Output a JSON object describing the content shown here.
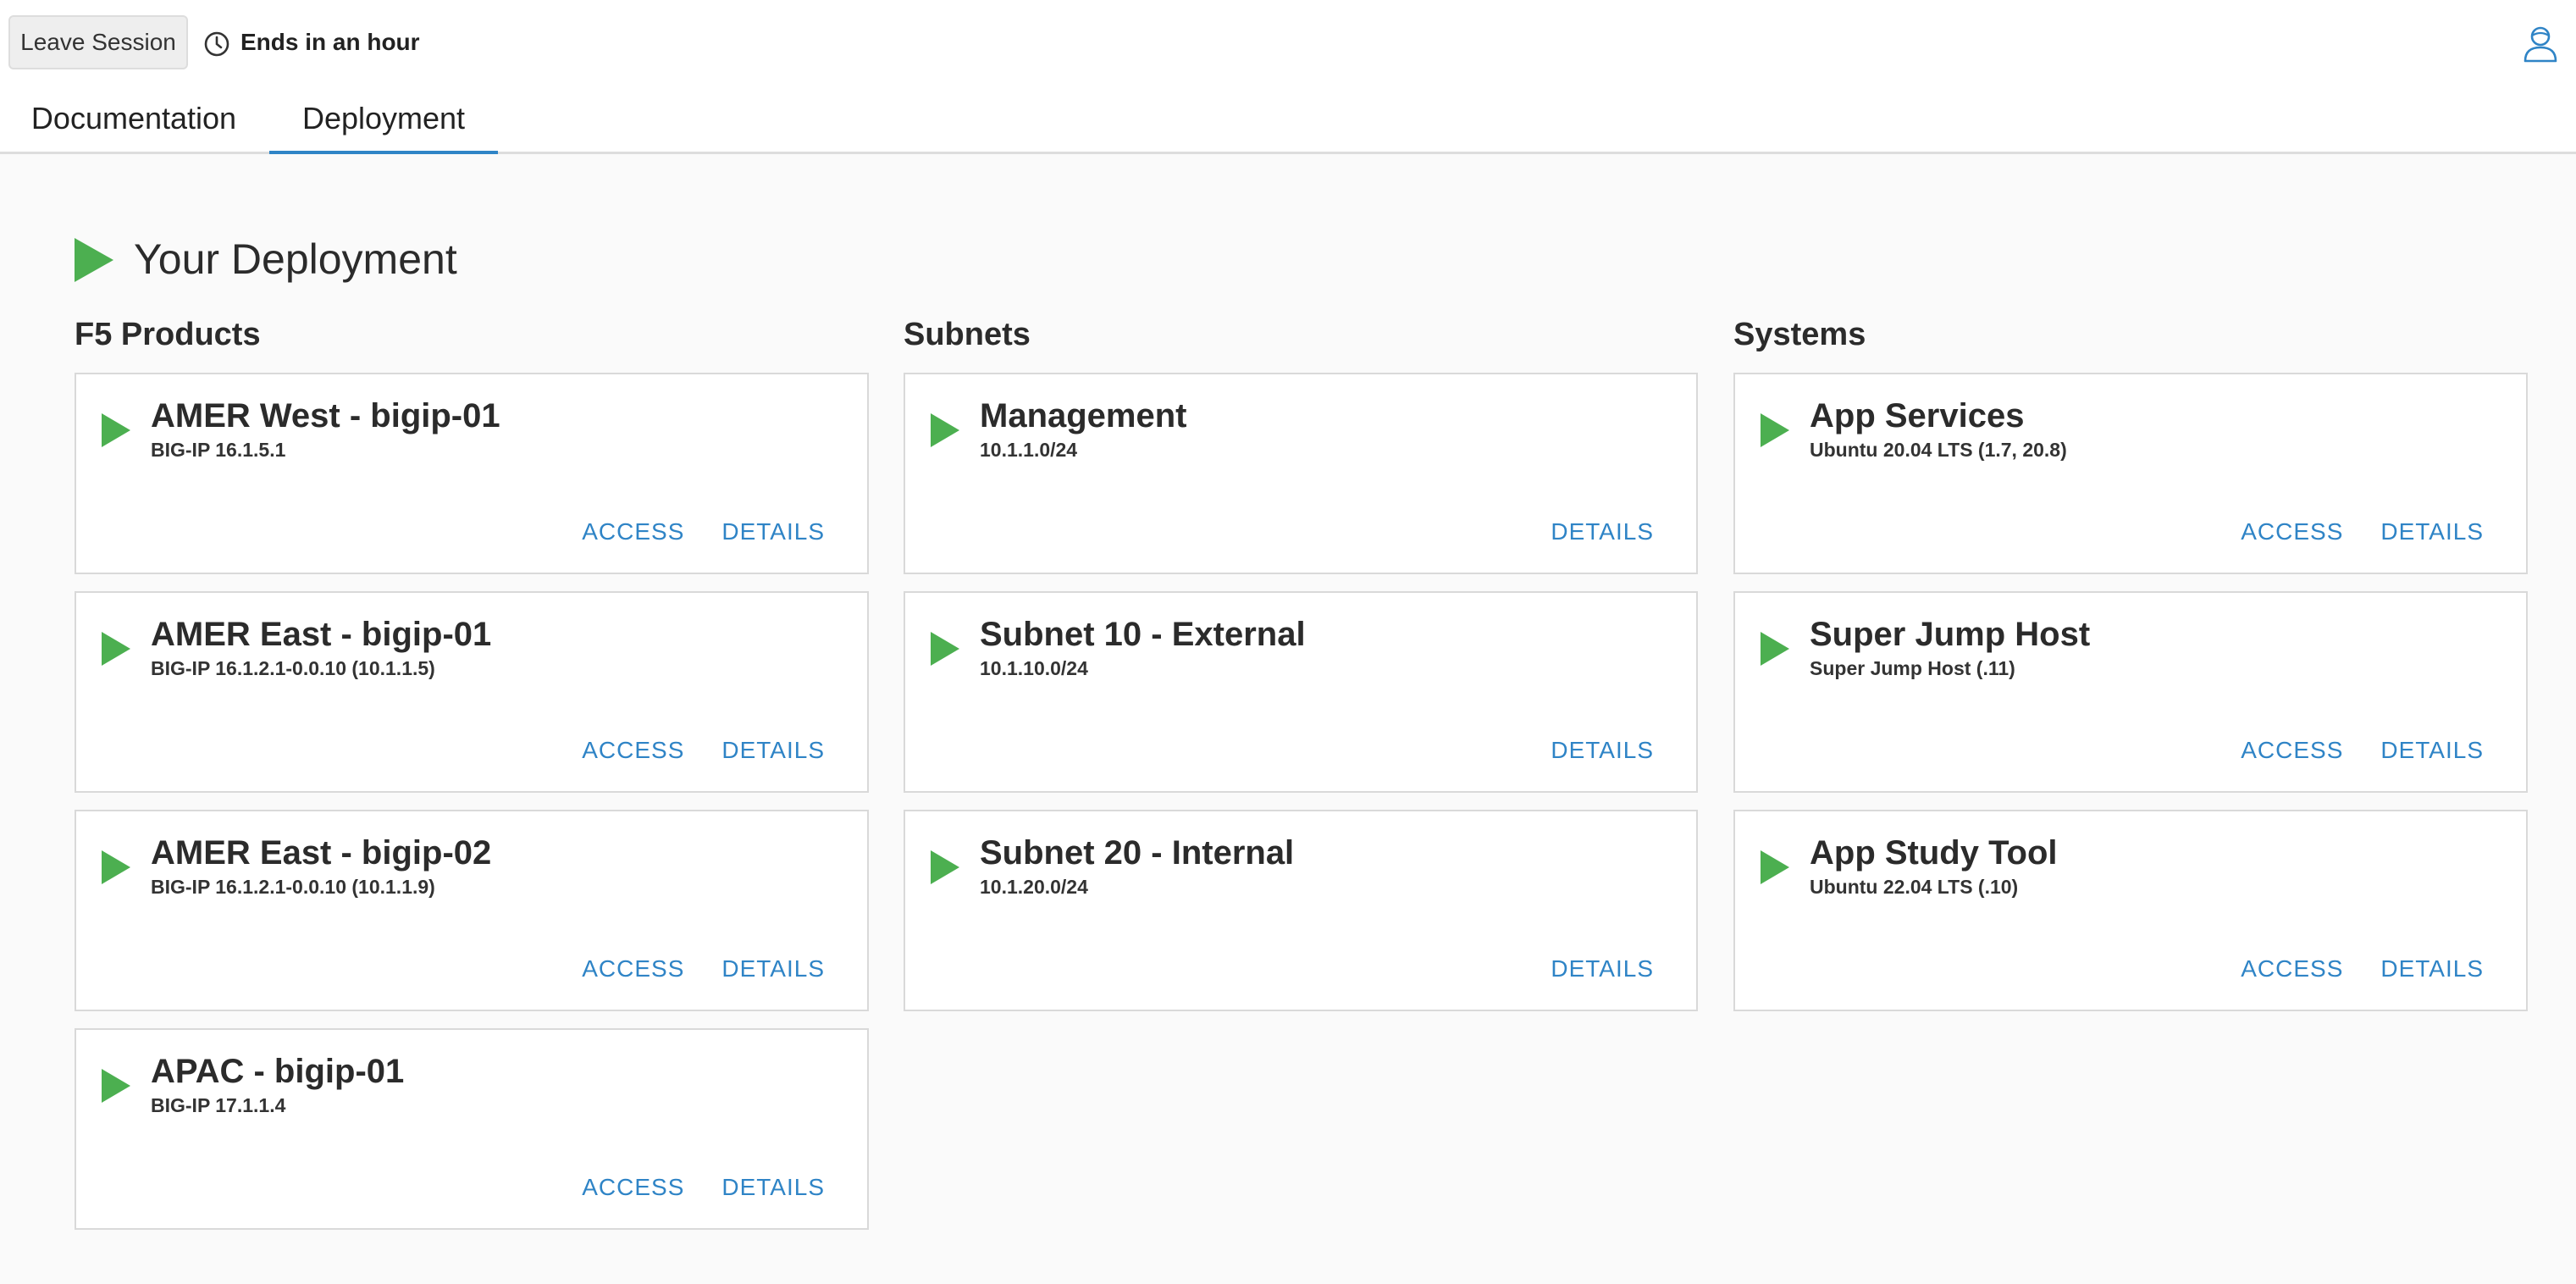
{
  "header": {
    "leave_label": "Leave Session",
    "timer_text": "Ends in an hour"
  },
  "tabs": [
    {
      "label": "Documentation",
      "active": false
    },
    {
      "label": "Deployment",
      "active": true
    }
  ],
  "main": {
    "title": "Your Deployment",
    "columns": [
      {
        "heading": "F5 Products",
        "cards": [
          {
            "title": "AMER West - bigip-01",
            "subtitle": "BIG-IP 16.1.5.1",
            "access": "ACCESS",
            "details": "DETAILS"
          },
          {
            "title": "AMER East - bigip-01",
            "subtitle": "BIG-IP 16.1.2.1-0.0.10 (10.1.1.5)",
            "access": "ACCESS",
            "details": "DETAILS"
          },
          {
            "title": "AMER East - bigip-02",
            "subtitle": "BIG-IP 16.1.2.1-0.0.10 (10.1.1.9)",
            "access": "ACCESS",
            "details": "DETAILS"
          },
          {
            "title": "APAC - bigip-01",
            "subtitle": "BIG-IP 17.1.1.4",
            "access": "ACCESS",
            "details": "DETAILS"
          }
        ]
      },
      {
        "heading": "Subnets",
        "cards": [
          {
            "title": "Management",
            "subtitle": "10.1.1.0/24",
            "details": "DETAILS"
          },
          {
            "title": "Subnet 10 - External",
            "subtitle": "10.1.10.0/24",
            "details": "DETAILS"
          },
          {
            "title": "Subnet 20 - Internal",
            "subtitle": "10.1.20.0/24",
            "details": "DETAILS"
          }
        ]
      },
      {
        "heading": "Systems",
        "cards": [
          {
            "title": "App Services",
            "subtitle": "Ubuntu 20.04 LTS (1.7, 20.8)",
            "access": "ACCESS",
            "details": "DETAILS"
          },
          {
            "title": "Super Jump Host",
            "subtitle": "Super Jump Host (.11)",
            "access": "ACCESS",
            "details": "DETAILS"
          },
          {
            "title": "App Study Tool",
            "subtitle": "Ubuntu 22.04 LTS (.10)",
            "access": "ACCESS",
            "details": "DETAILS"
          }
        ]
      }
    ]
  },
  "icons": {
    "status_icon": "play-icon",
    "timer_icon": "clock-icon",
    "user_icon": "user-icon"
  },
  "colors": {
    "accent": "#2f84c6",
    "status_green": "#4caf50",
    "background": "#fafafa",
    "card_border": "#d9d9d9"
  }
}
